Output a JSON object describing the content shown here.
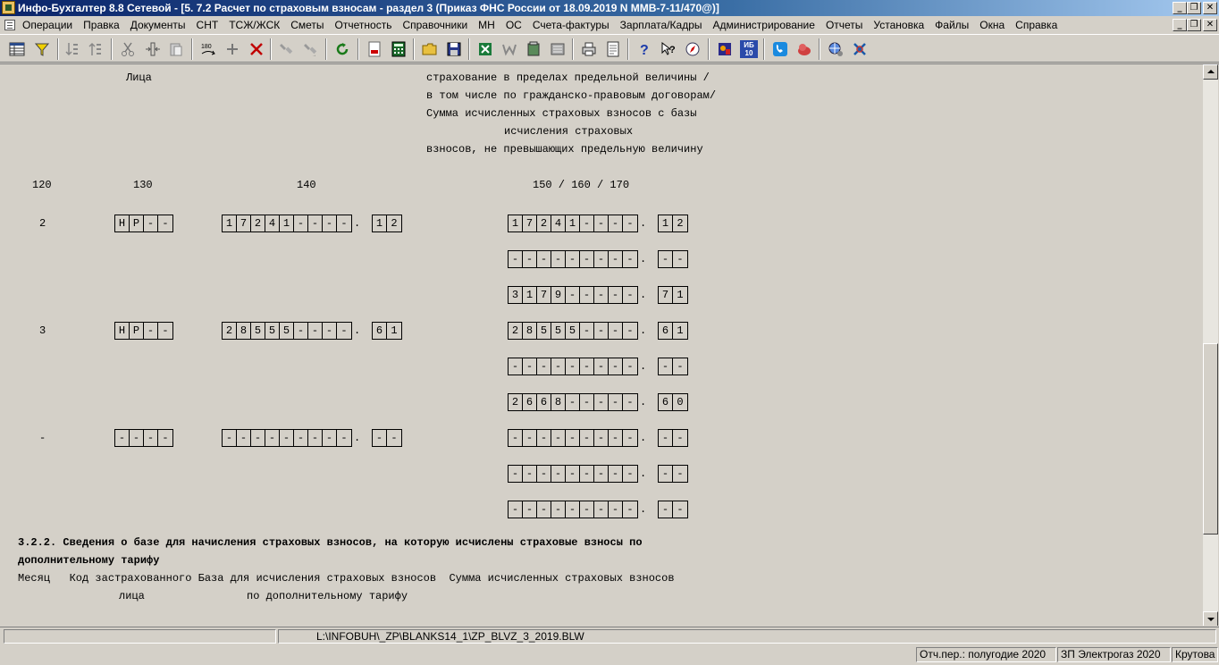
{
  "window": {
    "title": "Инфо-Бухгалтер 8.8 Сетевой - [5.  7.2 Расчет по страховым взносам - раздел 3 (Приказ ФНС России от 18.09.2019 N ММВ-7-11/470@)]",
    "minimize": "_",
    "restore": "❐",
    "close": "✕"
  },
  "menu": {
    "items": [
      "Операции",
      "Правка",
      "Документы",
      "СНТ",
      "ТСЖ/ЖСК",
      "Сметы",
      "Отчетность",
      "Справочники",
      "МН",
      "ОС",
      "Счета-фактуры",
      "Зарплата/Кадры",
      "Администрирование",
      "Отчеты",
      "Установка",
      "Файлы",
      "Окна",
      "Справка"
    ]
  },
  "toolbar": {
    "icons": [
      "table-view-icon",
      "filter-icon",
      "sort-asc-icon",
      "sort-desc-icon",
      "copy-icon",
      "cut-icon",
      "insert-column-icon",
      "paste-icon",
      "rotate-180-icon",
      "add-icon",
      "delete-icon",
      "flashlight-icon",
      "flashlight-next-icon",
      "refresh-icon",
      "pdf-icon",
      "calculator-icon",
      "open-folder-icon",
      "save-icon",
      "excel-icon",
      "word-icon",
      "export-icon",
      "archive-icon",
      "print-icon",
      "preview-icon",
      "help-icon",
      "context-help-icon",
      "compass-icon",
      "notes-icon",
      "info-badge-icon",
      "telephone-icon",
      "cloud-icon",
      "web-icon",
      "tools-icon"
    ],
    "info_badge_label": "ИБ 10"
  },
  "doc": {
    "header_col_left": "Лица",
    "header_right_lines": [
      "страхование в пределах предельной величины /",
      "в том числе по гражданско-правовым договорам/",
      "Сумма исчисленных страховых взносов с базы",
      "исчисления страховых",
      "взносов, не превышающих предельную величину"
    ],
    "col_codes": {
      "c120": "120",
      "c130": "130",
      "c140": "140",
      "c150": "150 / 160 / 170"
    },
    "rows": [
      {
        "month": "2",
        "code": [
          "Н",
          "Р",
          "-",
          "-"
        ],
        "base": [
          "1",
          "7",
          "2",
          "4",
          "1",
          "-",
          "-",
          "-",
          "-"
        ],
        "base_kop": [
          "1",
          "2"
        ],
        "sums": [
          {
            "rub": [
              "1",
              "7",
              "2",
              "4",
              "1",
              "-",
              "-",
              "-",
              "-"
            ],
            "kop": [
              "1",
              "2"
            ]
          },
          {
            "rub": [
              "-",
              "-",
              "-",
              "-",
              "-",
              "-",
              "-",
              "-",
              "-"
            ],
            "kop": [
              "-",
              "-"
            ]
          },
          {
            "rub": [
              "3",
              "1",
              "7",
              "9",
              "-",
              "-",
              "-",
              "-",
              "-"
            ],
            "kop": [
              "7",
              "1"
            ]
          }
        ]
      },
      {
        "month": "3",
        "code": [
          "Н",
          "Р",
          "-",
          "-"
        ],
        "base": [
          "2",
          "8",
          "5",
          "5",
          "5",
          "-",
          "-",
          "-",
          "-"
        ],
        "base_kop": [
          "6",
          "1"
        ],
        "sums": [
          {
            "rub": [
              "2",
              "8",
              "5",
              "5",
              "5",
              "-",
              "-",
              "-",
              "-"
            ],
            "kop": [
              "6",
              "1"
            ]
          },
          {
            "rub": [
              "-",
              "-",
              "-",
              "-",
              "-",
              "-",
              "-",
              "-",
              "-"
            ],
            "kop": [
              "-",
              "-"
            ]
          },
          {
            "rub": [
              "2",
              "6",
              "6",
              "8",
              "-",
              "-",
              "-",
              "-",
              "-"
            ],
            "kop": [
              "6",
              "0"
            ]
          }
        ]
      },
      {
        "month": "-",
        "code": [
          "-",
          "-",
          "-",
          "-"
        ],
        "base": [
          "-",
          "-",
          "-",
          "-",
          "-",
          "-",
          "-",
          "-",
          "-"
        ],
        "base_kop": [
          "-",
          "-"
        ],
        "sums": [
          {
            "rub": [
              "-",
              "-",
              "-",
              "-",
              "-",
              "-",
              "-",
              "-",
              "-"
            ],
            "kop": [
              "-",
              "-"
            ]
          },
          {
            "rub": [
              "-",
              "-",
              "-",
              "-",
              "-",
              "-",
              "-",
              "-",
              "-"
            ],
            "kop": [
              "-",
              "-"
            ]
          },
          {
            "rub": [
              "-",
              "-",
              "-",
              "-",
              "-",
              "-",
              "-",
              "-",
              "-"
            ],
            "kop": [
              "-",
              "-"
            ]
          }
        ]
      }
    ],
    "section_title_line1": "3.2.2. Сведения о базе для начисления страховых взносов, на которую исчислены страховые взносы по",
    "section_title_line2": "дополнительному тарифу",
    "section_header_line1": "Месяц   Код застрахованного База для исчисления страховых взносов  Сумма исчисленных страховых взносов",
    "section_header_line2a": "лица",
    "section_header_line2b": "по дополнительному тарифу"
  },
  "status": {
    "path": "L:\\INFOBUH\\_ZP\\BLANKS14_1\\ZP_BLVZ_3_2019.BLW",
    "period": "Отч.пер.: полугодие 2020",
    "company": "ЗП Электрогаз 2020",
    "user": "Крутова"
  }
}
